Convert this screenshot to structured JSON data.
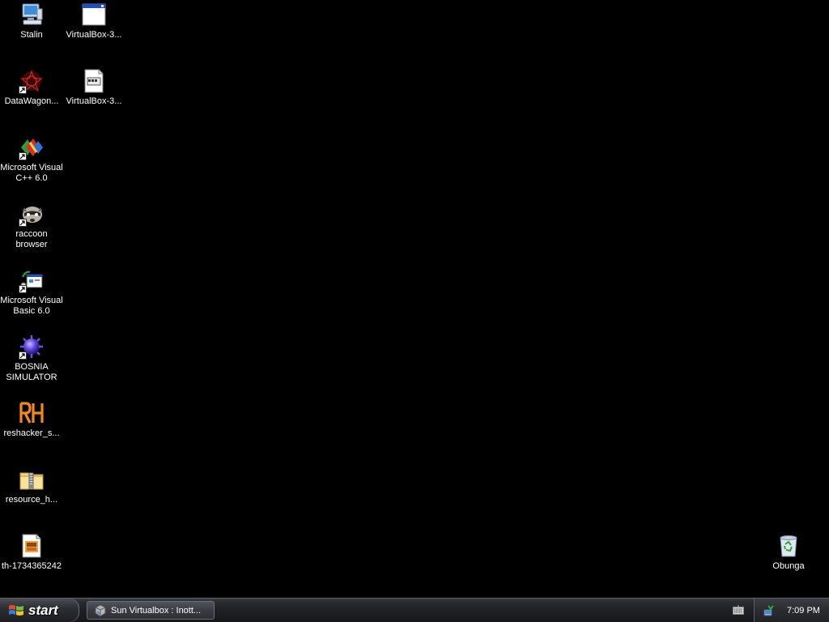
{
  "desktop": {
    "icons": [
      {
        "label": "Stalin",
        "icon": "my-computer-icon"
      },
      {
        "label": "VirtualBox-3...",
        "icon": "window-file-icon"
      },
      {
        "label": "DataWagon...",
        "icon": "datawagon-icon"
      },
      {
        "label": "VirtualBox-3...",
        "icon": "document-file-icon"
      },
      {
        "label": "Microsoft Visual C++ 6.0",
        "icon": "visual-cpp-icon"
      },
      {
        "label": "raccoon browser",
        "icon": "raccoon-icon"
      },
      {
        "label": "Microsoft Visual Basic 6.0",
        "icon": "visual-basic-icon"
      },
      {
        "label": "BOSNIA SIMULATOR",
        "icon": "bosnia-simulator-icon"
      },
      {
        "label": "reshacker_s...",
        "icon": "reshacker-icon"
      },
      {
        "label": "resource_h...",
        "icon": "zip-folder-icon"
      },
      {
        "label": "th-1734365242",
        "icon": "image-file-icon"
      },
      {
        "label": "Obunga",
        "icon": "recycle-bin-icon"
      }
    ]
  },
  "taskbar": {
    "start_label": "start",
    "task_item_label": "Sun Virtualbox : Inott...",
    "clock": "7:09 PM"
  },
  "colors": {
    "desktop_background": "#000000",
    "label_text": "#ffffff"
  }
}
